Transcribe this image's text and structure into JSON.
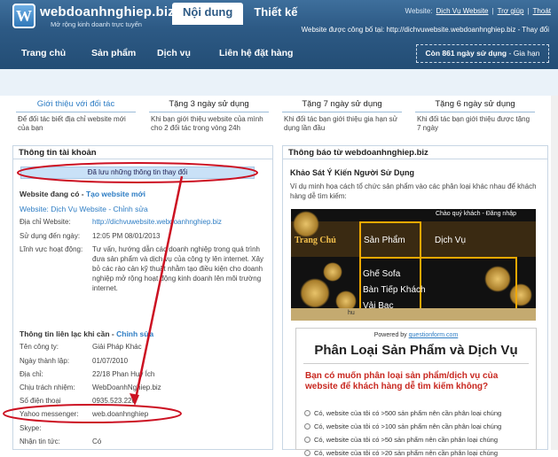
{
  "brand": {
    "logo_letter": "W",
    "name": "webdoanhnghiep.biz",
    "tagline": "Mở rộng kinh doanh trực tuyến"
  },
  "tabs": [
    {
      "label": "Nội dung"
    },
    {
      "label": "Thiết kế"
    }
  ],
  "toplinks": {
    "prefix": "Website:",
    "site": "Dịch Vụ Website",
    "sep1": "|",
    "help": "Trợ giúp",
    "sep2": "|",
    "logout": "Thoát"
  },
  "announce": "Website được công bố tại: http://dichvuwebsite.webdoanhnghiep.biz - Thay đổi",
  "nav": [
    "Trang chủ",
    "Sản phẩm",
    "Dịch vụ",
    "Liên hệ đặt hàng"
  ],
  "users": {
    "text": "Còn 861 ngày sử dụng",
    "link": "Gia hạn",
    "sep": "-"
  },
  "promos": [
    {
      "title": "Giới thiệu với đối tác",
      "desc": "Để đối tác biết địa chỉ website mới của bạn"
    },
    {
      "title": "Tặng 3 ngày sử dụng",
      "desc": "Khi bạn giới thiệu website của mình cho 2 đối tác trong vòng 24h"
    },
    {
      "title": "Tặng 7 ngày sử dụng",
      "desc": "Khi đối tác bạn giới thiệu gia hạn sử dụng lần đầu"
    },
    {
      "title": "Tặng 6 ngày sử dụng",
      "desc": "Khi đối tác bạn giới thiệu được tặng 7 ngày"
    }
  ],
  "account": {
    "title": "Thông tin tài khoản",
    "saved_msg": "Đã lưu những thông tin thay đổi",
    "site_head": "Website đang có -",
    "site_create": "Tạo website mới",
    "site_name": "Website: Dịch Vụ Website",
    "site_edit": "Chỉnh sửa",
    "site_edit_sep": "-",
    "rows": [
      {
        "label": "Địa chỉ Website:",
        "value": "http://dichvuwebsite.webdoanhnghiep.biz"
      },
      {
        "label": "Sử dụng đến ngày:",
        "value": "12:05 PM 08/01/2013"
      },
      {
        "label": "Lĩnh vực hoạt động:",
        "value": "Tư vấn, hướng dẫn các doanh nghiệp trong quá trình đưa sản phẩm và dịch vụ của công ty lên internet. Xây bỏ các rào cản kỹ thuật nhằm tạo điều kiện cho doanh nghiệp mở rộng hoạt động kinh doanh lên môi trường internet."
      }
    ],
    "contact_head": "Thông tin liên lạc khi cần -",
    "contact_edit": "Chỉnh sửa",
    "contact_rows": [
      {
        "label": "Tên công ty:",
        "value": "Giải Pháp Khác"
      },
      {
        "label": "Ngày thành lập:",
        "value": "01/07/2010"
      },
      {
        "label": "Địa chỉ:",
        "value": "22/18 Phan Huy Ích"
      },
      {
        "label": "Chịu trách nhiệm:",
        "value": "WebDoanhNghiep.biz"
      },
      {
        "label": "Số điện thoại",
        "value": "0935.523.220"
      },
      {
        "label": "Yahoo messenger:",
        "value": "web.doanhnghiep"
      },
      {
        "label": "Skype:",
        "value": ""
      },
      {
        "label": "Nhận tin tức:",
        "value": "Có"
      }
    ]
  },
  "notice": {
    "title": "Thông báo từ webdoanhnghiep.biz",
    "subtitle": "Khảo Sát Ý Kiến Người Sử Dụng",
    "text": "Ví dụ minh họa cách tổ chức sản phẩm vào các phân loại khác nhau để khách hàng dễ tìm kiếm:",
    "shot": {
      "chat": "Chào quý khách - Đăng nhập",
      "home": "Trang Chủ",
      "cats": [
        "Sản Phẩm",
        "Dịch Vụ"
      ],
      "items": [
        "Ghế Sofa",
        "Bàn Tiếp Khách",
        "Vải Bạc"
      ],
      "footer": "hu"
    },
    "form": {
      "powered": "Powered by",
      "powered_link": "questionform.com",
      "title": "Phân Loại Sản Phẩm và Dịch Vụ",
      "question": "Bạn có muốn phân loại sản phẩm/dịch vụ của website để khách hàng dễ tìm kiếm không?",
      "options": [
        "Có, website của tôi có >500 sản phẩm nên cần phân loại chúng",
        "Có, website của tôi có >100 sản phẩm nên cần phân loại chúng",
        "Có, website của tôi có >50 sản phẩm nên cần phân loại chúng",
        "Có, website của tôi có >20 sản phẩm nên cần phân loại chúng"
      ]
    }
  },
  "colors": {
    "header": "#2d5a85",
    "link": "#2e7dc4",
    "annotation": "#cc1122",
    "highlight": "#f0a800"
  }
}
